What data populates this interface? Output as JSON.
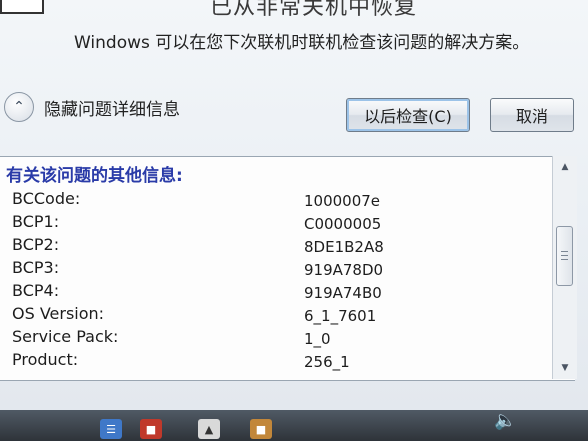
{
  "dialog": {
    "title_partial": "已从非常关机中恢复",
    "message": "Windows 可以在您下次联机时联机检查该问题的解决方案。",
    "toggle_label": "隐藏问题详细信息",
    "buttons": {
      "check_later": "以后检查(C)",
      "cancel": "取消"
    }
  },
  "details": {
    "header": "有关该问题的其他信息:",
    "rows": [
      {
        "label": "BCCode:",
        "value": "1000007e"
      },
      {
        "label": "BCP1:",
        "value": "C0000005"
      },
      {
        "label": "BCP2:",
        "value": "8DE1B2A8"
      },
      {
        "label": "BCP3:",
        "value": "919A78D0"
      },
      {
        "label": "BCP4:",
        "value": "919A74B0"
      },
      {
        "label": "OS Version:",
        "value": "6_1_7601"
      },
      {
        "label": "Service Pack:",
        "value": "1_0"
      },
      {
        "label": "Product:",
        "value": "256_1"
      }
    ]
  },
  "colors": {
    "header_text": "#2a3ba8",
    "button_focus": "#9cc3e8"
  },
  "icons": {
    "toggle": "chevron-up-icon",
    "tray": "speaker-icon"
  }
}
